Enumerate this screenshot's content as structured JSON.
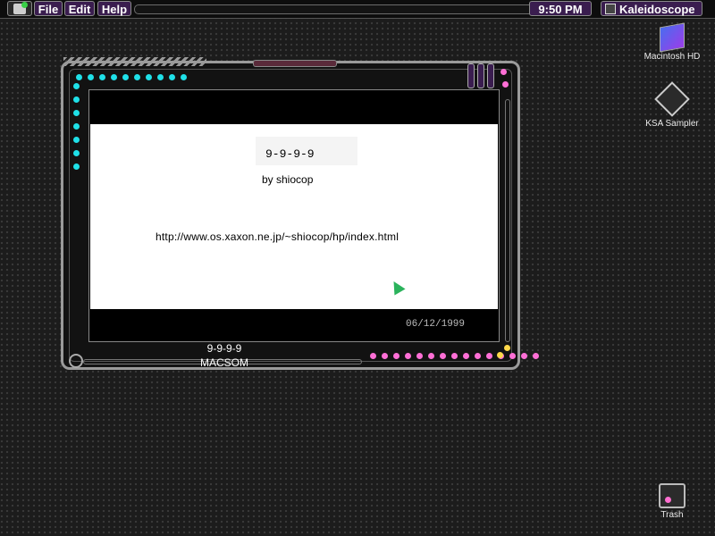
{
  "menubar": {
    "items": [
      "File",
      "Edit",
      "Help"
    ],
    "clock": "9:50 PM",
    "active_app": "Kaleidoscope"
  },
  "desktop": {
    "icons": [
      {
        "label": "Macintosh HD",
        "icon": "hard-disk-icon"
      },
      {
        "label": "KSA Sampler",
        "icon": "ksa-sampler-icon"
      },
      {
        "label": "Trash",
        "icon": "trash-icon"
      }
    ]
  },
  "window": {
    "title": "9-9-9-9",
    "byline": "by shiocop",
    "url": "http://www.os.xaxon.ne.jp/~shiocop/hp/index.html",
    "date": "06/12/1999",
    "footer_title": "9-9-9-9",
    "footer_sub": "MACSOM"
  },
  "colors": {
    "accent_purple": "#3a1d4f",
    "dot_cyan": "#1fe0e8",
    "dot_pink": "#ff6fd6",
    "dot_yellow": "#ffd84a"
  }
}
